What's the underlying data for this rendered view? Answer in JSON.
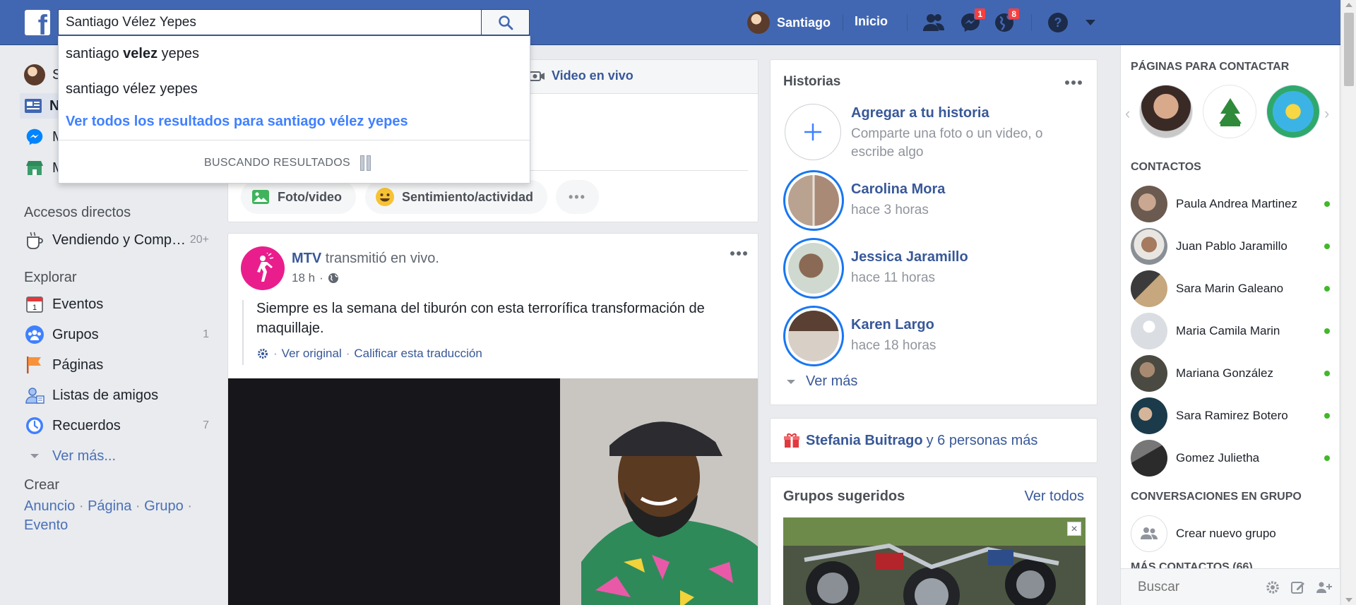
{
  "colors": {
    "brand": "#4267b2",
    "link": "#385898",
    "accent": "#4080ff",
    "badge": "#fa3e3e",
    "online": "#42b72a"
  },
  "topbar": {
    "logo_letter": "f",
    "search_value": "Santiago Vélez Yepes",
    "user_name": "Santiago",
    "home_label": "Inicio",
    "messages_badge": "1",
    "notifications_badge": "8"
  },
  "search_dropdown": {
    "suggestion_1_pre": "santiago ",
    "suggestion_1_bold": "velez",
    "suggestion_1_post": " yepes",
    "suggestion_2": "santiago vélez yepes",
    "see_all": "Ver todos los resultados para santiago vélez yepes",
    "loading": "BUSCANDO RESULTADOS"
  },
  "left_nav": {
    "profile_initial": "S",
    "row2_initial": "N",
    "row3_initial": "M",
    "row4_initial": "M",
    "shortcuts_title": "Accesos directos",
    "shortcut_1": "Vendiendo y Comp…",
    "shortcut_1_count": "20+",
    "explore_title": "Explorar",
    "explore": [
      {
        "label": "Eventos",
        "count": ""
      },
      {
        "label": "Grupos",
        "count": "1"
      },
      {
        "label": "Páginas",
        "count": ""
      },
      {
        "label": "Listas de amigos",
        "count": ""
      },
      {
        "label": "Recuerdos",
        "count": "7"
      }
    ],
    "see_more": "Ver más...",
    "create_title": "Crear",
    "create_links": [
      "Anuncio",
      "Página",
      "Grupo",
      "Evento"
    ],
    "create_sep": "·"
  },
  "composer": {
    "live_video": "Video en vivo",
    "photo_video": "Foto/video",
    "feeling": "Sentimiento/actividad",
    "more": "•••"
  },
  "post": {
    "author": "MTV",
    "action": "transmitió en vivo.",
    "time": "18 h",
    "meta_sep": "·",
    "text": "Siempre es la semana del tiburón con esta terrorífica transformación de maquillaje.",
    "see_original": "Ver original",
    "rate_translation": "Calificar esta traducción",
    "trans_sep": "·"
  },
  "stories": {
    "title": "Historias",
    "add_title": "Agregar a tu historia",
    "add_sub": "Comparte una foto o un video, o escribe algo",
    "items": [
      {
        "name": "Carolina Mora",
        "time": "hace 3 horas"
      },
      {
        "name": "Jessica Jaramillo",
        "time": "hace 11 horas"
      },
      {
        "name": "Karen Largo",
        "time": "hace 18 horas"
      }
    ],
    "see_more": "Ver más"
  },
  "birthday": {
    "name": "Stefania Buitrago",
    "rest": "y 6 personas más"
  },
  "groups": {
    "title": "Grupos sugeridos",
    "see_all": "Ver todos",
    "close": "×"
  },
  "chat": {
    "pages_title": "PÁGINAS PARA CONTACTAR",
    "contacts_title": "CONTACTOS",
    "contacts": [
      "Paula Andrea Martinez",
      "Juan Pablo Jaramillo",
      "Sara Marin Galeano",
      "Maria Camila Marin",
      "Mariana González",
      "Sara Ramirez Botero",
      "Gomez Julietha"
    ],
    "group_convos_title": "CONVERSACIONES EN GRUPO",
    "new_group": "Crear nuevo grupo",
    "more_contacts": "MÁS CONTACTOS (66)",
    "search_placeholder": "Buscar"
  }
}
